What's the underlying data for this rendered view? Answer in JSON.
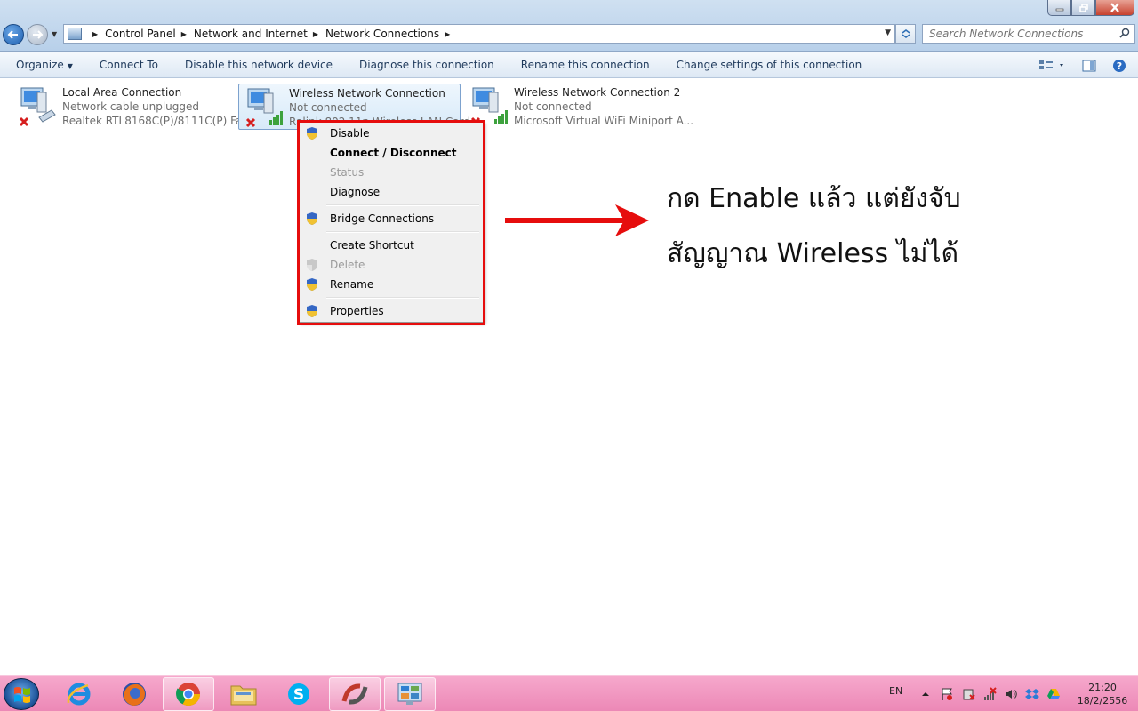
{
  "address": {
    "breadcrumbs": [
      {
        "label": "Control Panel"
      },
      {
        "label": "Network and Internet"
      },
      {
        "label": "Network Connections"
      }
    ]
  },
  "search": {
    "placeholder": "Search Network Connections"
  },
  "toolbar": {
    "organize": "Organize",
    "commands": [
      {
        "label": "Connect To"
      },
      {
        "label": "Disable this network device"
      },
      {
        "label": "Diagnose this connection"
      },
      {
        "label": "Rename this connection"
      },
      {
        "label": "Change settings of this connection"
      }
    ]
  },
  "connections": [
    {
      "name": "Local Area Connection",
      "status": "Network cable unplugged",
      "device": "Realtek RTL8168C(P)/8111C(P) Fa...",
      "icon": "wired-network-icon",
      "error": true
    },
    {
      "name": "Wireless Network Connection",
      "status": "Not connected",
      "device": "Ralink 802.11n Wireless LAN Card",
      "icon": "wireless-network-icon",
      "error": true,
      "selected": true
    },
    {
      "name": "Wireless Network Connection 2",
      "status": "Not connected",
      "device": "Microsoft Virtual WiFi Miniport A...",
      "icon": "wireless-network-icon",
      "error": true
    }
  ],
  "context_menu": {
    "items": [
      {
        "label": "Disable",
        "shield": true
      },
      {
        "label": "Connect / Disconnect",
        "bold": true
      },
      {
        "label": "Status",
        "disabled": true
      },
      {
        "label": "Diagnose"
      },
      {
        "label": "Bridge Connections",
        "shield": true
      },
      {
        "label": "Create Shortcut"
      },
      {
        "label": "Delete",
        "shield": true,
        "disabled": true
      },
      {
        "label": "Rename",
        "shield": true
      },
      {
        "label": "Properties",
        "shield": true
      }
    ]
  },
  "annotation": {
    "line1": "กด Enable แล้ว แต่ยังจับ",
    "line2": "สัญญาณ Wireless ไม่ได้",
    "color": "#e60d0d"
  },
  "taskbar": {
    "apps": [
      {
        "name": "internet-explorer-icon"
      },
      {
        "name": "firefox-icon"
      },
      {
        "name": "chrome-icon"
      },
      {
        "name": "file-explorer-icon"
      },
      {
        "name": "skype-icon"
      },
      {
        "name": "media-app-icon"
      },
      {
        "name": "network-control-panel-icon"
      }
    ],
    "language": "EN",
    "time": "21:20",
    "date": "18/2/2556"
  }
}
